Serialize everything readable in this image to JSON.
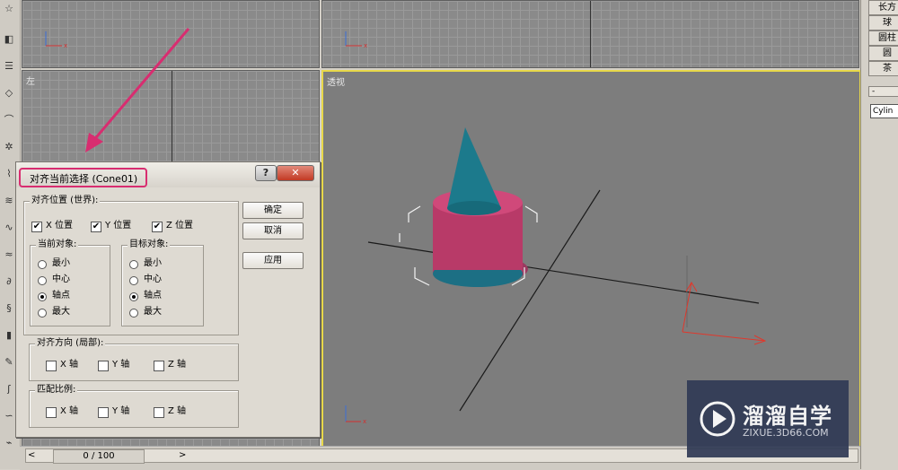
{
  "viewports": {
    "top_left_axes": "x",
    "left_label": "左",
    "persp_label": "透视"
  },
  "right_panel": {
    "buttons": [
      "长方",
      "球",
      "圆柱",
      "圆",
      "茶"
    ],
    "dash": "-",
    "name_field": "Cylin"
  },
  "dialog": {
    "title": "对齐当前选择 (Cone01)",
    "help": "?",
    "close": "✕",
    "align_position": {
      "label": "对齐位置 (世界):",
      "x": "X 位置",
      "y": "Y 位置",
      "z": "Z 位置",
      "x_checked": true,
      "y_checked": true,
      "z_checked": true
    },
    "current_object": {
      "label": "当前对象:",
      "options": [
        "最小",
        "中心",
        "轴点",
        "最大"
      ],
      "selected": "轴点"
    },
    "target_object": {
      "label": "目标对象:",
      "options": [
        "最小",
        "中心",
        "轴点",
        "最大"
      ],
      "selected": "轴点"
    },
    "align_orientation": {
      "label": "对齐方向 (局部):",
      "x": "X 轴",
      "y": "Y 轴",
      "z": "Z 轴"
    },
    "match_scale": {
      "label": "匹配比例:",
      "x": "X 轴",
      "y": "Y 轴",
      "z": "Z 轴"
    },
    "ok": "确定",
    "cancel": "取消",
    "apply": "应用"
  },
  "timeline": {
    "frame": "0 / 100",
    "prev": "<",
    "next": ">"
  },
  "watermark": {
    "title": "溜溜自学",
    "url": "ZIXUE.3D66.COM"
  },
  "colors": {
    "highlight": "#d82d70",
    "active_viewport_border": "#e8d84a",
    "cone": "#1c7a8c",
    "cylinder": "#b83a68"
  }
}
